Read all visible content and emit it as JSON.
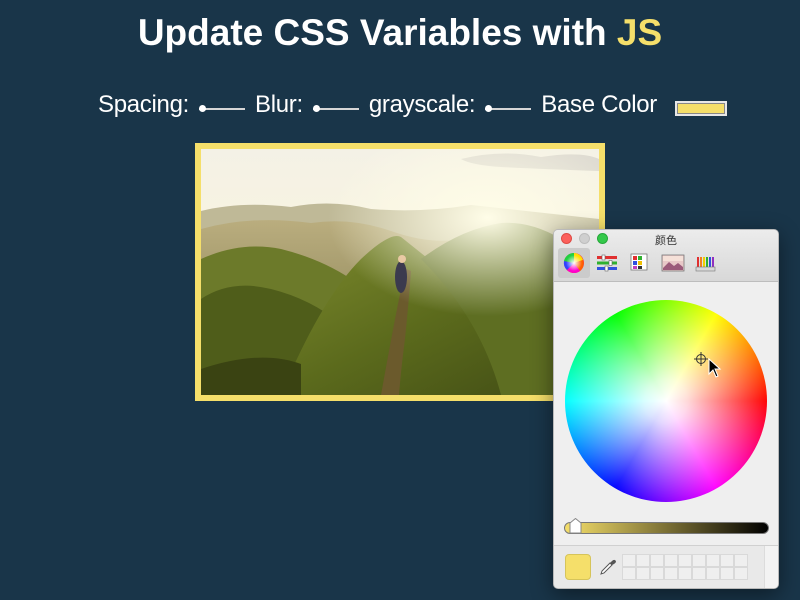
{
  "header": {
    "title_main": "Update CSS Variables with",
    "title_highlight": "JS"
  },
  "controls": {
    "spacing_label": "Spacing:",
    "blur_label": "Blur:",
    "grayscale_label": "grayscale:",
    "base_color_label": "Base Color",
    "spacing_value": 0,
    "blur_value": 0,
    "grayscale_value": 0,
    "base_color": "#f5df6a"
  },
  "colors": {
    "background": "#193549",
    "accent": "#f5df6a",
    "photo_border": "#f5df6a"
  },
  "color_panel": {
    "title": "颜色",
    "modes": [
      "color-wheel-icon",
      "sliders-icon",
      "palettes-icon",
      "image-palettes-icon",
      "pencils-icon"
    ],
    "active_mode": "color-wheel-icon",
    "selected_color": "#f5df6a",
    "brightness_value": 1
  }
}
